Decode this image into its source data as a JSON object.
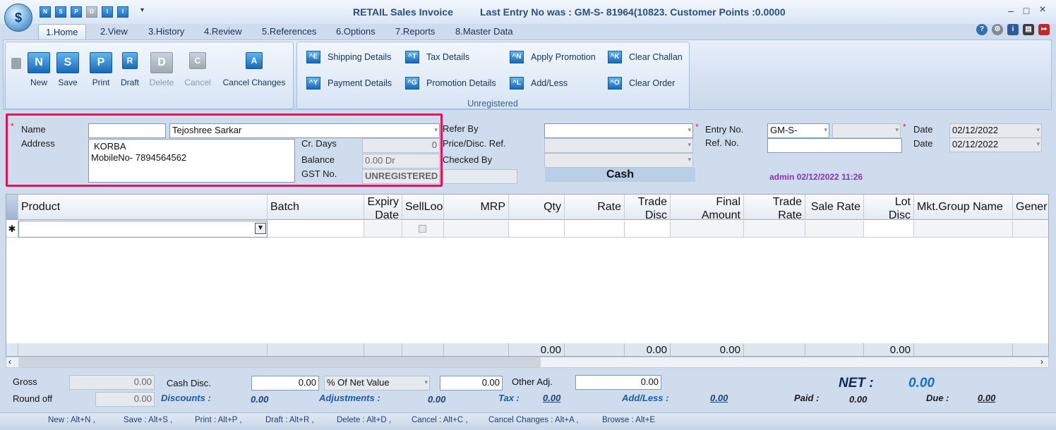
{
  "window": {
    "title": "RETAIL Sales Invoice",
    "status_line": "Last Entry No was : GM-S- 81964(10823.  Customer Points :0.0000",
    "min": "–",
    "max": "□",
    "close": "×"
  },
  "quick_access": [
    "N",
    "S",
    "P",
    "D",
    "I",
    "I"
  ],
  "tabs": [
    "1.Home",
    "2.View",
    "3.History",
    "4.Review",
    "5.References",
    "6.Options",
    "7.Reports",
    "8.Master Data"
  ],
  "ribbon": {
    "main_buttons": [
      {
        "glyph": "N",
        "label": "New",
        "enabled": true
      },
      {
        "glyph": "S",
        "label": "Save",
        "enabled": true
      },
      {
        "glyph": "P",
        "label": "Print",
        "enabled": true
      },
      {
        "glyph": "R",
        "label": "Draft",
        "enabled": true
      },
      {
        "glyph": "D",
        "label": "Delete",
        "enabled": false
      },
      {
        "glyph": "C",
        "label": "Cancel",
        "enabled": false
      },
      {
        "glyph": "A",
        "label": "Cancel Changes",
        "enabled": true
      }
    ],
    "small_buttons": [
      {
        "glyph": "^E",
        "label": "Shipping Details"
      },
      {
        "glyph": "^T",
        "label": "Tax Details"
      },
      {
        "glyph": "^N",
        "label": "Apply Promotion"
      },
      {
        "glyph": "^K",
        "label": "Clear Challan"
      },
      {
        "glyph": "^Y",
        "label": "Payment Details"
      },
      {
        "glyph": "^G",
        "label": "Promotion Details"
      },
      {
        "glyph": "^L",
        "label": "Add/Less"
      },
      {
        "glyph": "^O",
        "label": "Clear Order"
      }
    ],
    "group_label": "Unregistered"
  },
  "form": {
    "required_mark": "*",
    "name_label": "Name",
    "name_code": "",
    "name_value": "Tejoshree Sarkar",
    "address_label": "Address",
    "address_line1": "KORBA",
    "address_line2": "MobileNo- 7894564562",
    "cr_days_label": "Cr. Days",
    "cr_days_value": "0",
    "balance_label": "Balance",
    "balance_value": "0.00 Dr",
    "gst_label": "GST No.",
    "gst_value": "UNREGISTERED",
    "refer_by_label": "Refer By",
    "refer_by_value": "",
    "price_disc_label": "Price/Disc. Ref.",
    "checked_by_label": "Checked By",
    "payment_mode": "Cash",
    "entry_no_label": "Entry No.",
    "entry_prefix": "GM-S-",
    "entry_no_value": "",
    "ref_no_label": "Ref. No.",
    "ref_no_value": "",
    "date_label": "Date",
    "date_value": "02/12/2022",
    "date2_label": "Date",
    "date2_value": "02/12/2022",
    "admin_stamp": "admin 02/12/2022 11:26"
  },
  "grid": {
    "columns": [
      {
        "key": "product",
        "label": "Product"
      },
      {
        "key": "batch",
        "label": "Batch"
      },
      {
        "key": "expiry",
        "label1": "Expiry",
        "label2": "Date"
      },
      {
        "key": "selllo",
        "label": "SellLoo"
      },
      {
        "key": "mrp",
        "label": "MRP"
      },
      {
        "key": "qty",
        "label": "Qty"
      },
      {
        "key": "rate",
        "label": "Rate"
      },
      {
        "key": "tradedisc",
        "label1": "Trade",
        "label2": "Disc"
      },
      {
        "key": "final",
        "label1": "Final",
        "label2": "Amount"
      },
      {
        "key": "traderate",
        "label1": "Trade",
        "label2": "Rate"
      },
      {
        "key": "salerate",
        "label": "Sale Rate"
      },
      {
        "key": "lotdisc",
        "label1": "Lot",
        "label2": "Disc"
      },
      {
        "key": "mktgroup",
        "label": "Mkt.Group Name"
      },
      {
        "key": "generic",
        "label": "Gener"
      }
    ],
    "new_row_marker": "✱",
    "totals": {
      "qty": "0.00",
      "tradedisc": "0.00",
      "final": "0.00",
      "lotdisc": "0.00"
    }
  },
  "footer": {
    "gross_label": "Gross",
    "gross_value": "0.00",
    "roundoff_label": "Round off",
    "roundoff_value": "0.00",
    "cash_disc_label": "Cash Disc.",
    "cash_disc_value": "0.00",
    "cash_disc_mode": "% Of Net Value",
    "cash_disc_amount": "0.00",
    "other_adj_label": "Other Adj.",
    "other_adj_value": "0.00",
    "discounts_label": "Discounts :",
    "discounts_value": "0.00",
    "adjustments_label": "Adjustments :",
    "adjustments_value": "0.00",
    "tax_label": "Tax :",
    "tax_value": "0.00",
    "addless_label": "Add/Less :",
    "addless_value": "0.00",
    "paid_label": "Paid :",
    "paid_value": "0.00",
    "due_label": "Due :",
    "due_value": "0.00",
    "net_label": "NET :",
    "net_value": "0.00"
  },
  "shortcuts": [
    "New : Alt+N ,",
    "Save : Alt+S ,",
    "Print : Alt+P ,",
    "Draft : Alt+R ,",
    "Delete : Alt+D ,",
    "Cancel : Alt+C ,",
    "Cancel Changes : Alt+A ,",
    "Browse : Alt+E"
  ]
}
